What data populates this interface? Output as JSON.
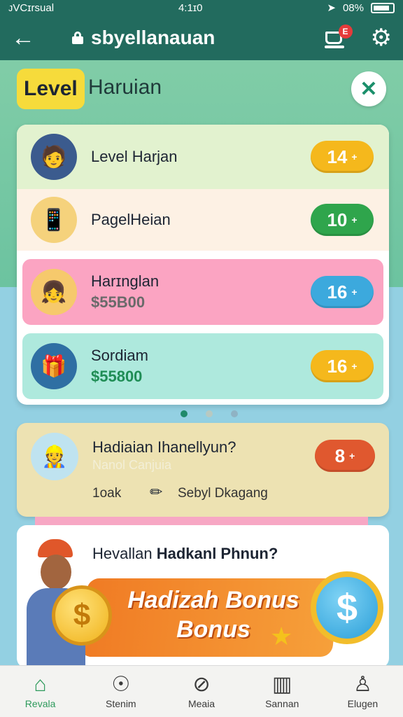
{
  "status_bar": {
    "carrier": "ᴊVCɪrsual",
    "time": "4:1ɪ0",
    "battery": "08%"
  },
  "app_bar": {
    "title": "sbyellanauan",
    "cart_badge": "E"
  },
  "heading": {
    "chip": "Level",
    "title": "Haruian"
  },
  "rows": [
    {
      "name": "Level Harjan",
      "price": "",
      "value": "14",
      "pill_color": "#f5b81c",
      "avatar_bg": "#3b5b8e",
      "avatar_icon": "🧑"
    },
    {
      "name": "PagelHeian",
      "price": "",
      "value": "10",
      "pill_color": "#2fa54c",
      "avatar_bg": "#f5d27c",
      "avatar_icon": "📱"
    },
    {
      "name": "Harɪnglan",
      "price": "$55B00",
      "value": "16",
      "pill_color": "#3ca9dd",
      "avatar_bg": "#f6c96c",
      "avatar_icon": "👧"
    },
    {
      "name": "Sordiam",
      "price": "$55800",
      "value": "16",
      "pill_color": "#f5b81c",
      "avatar_bg": "#2f6fa3",
      "avatar_icon": "🎁"
    }
  ],
  "promo": {
    "title": "Hadiaian Ihanellyun?",
    "subtitle": "Nanol Canjuia",
    "count": "1oak",
    "tag": "Sebyl Dkagang",
    "value": "8",
    "pill_color": "#e0582f"
  },
  "bonus": {
    "heading_prefix": "Hevallan ",
    "heading_bold": "Hadkanl Phnun?",
    "banner_line1": "Hadizah Bonus",
    "banner_line2": "Bonus"
  },
  "nav": [
    {
      "label": "Revala",
      "icon": "home-icon",
      "active": true
    },
    {
      "label": "Stenim",
      "icon": "chat-icon",
      "active": false
    },
    {
      "label": "Meaia",
      "icon": "clock-icon",
      "active": false
    },
    {
      "label": "Sannan",
      "icon": "book-icon",
      "active": false
    },
    {
      "label": "Elugen",
      "icon": "profile-icon",
      "active": false
    }
  ]
}
